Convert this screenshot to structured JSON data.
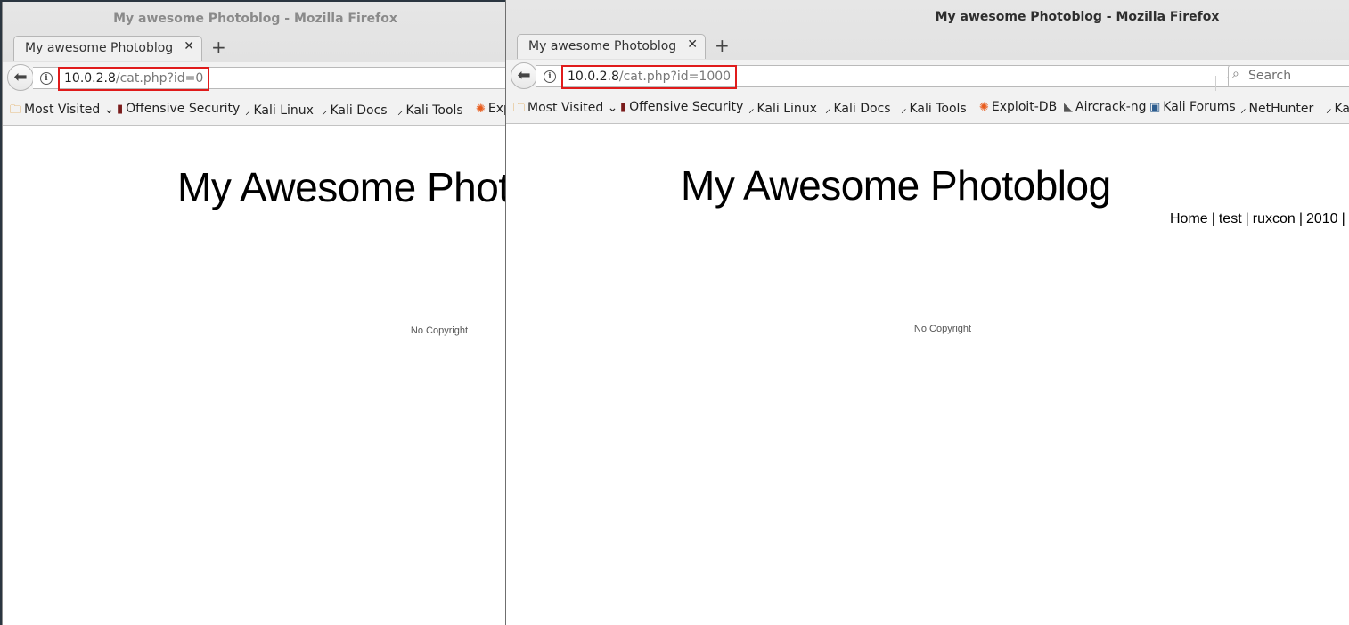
{
  "left_window": {
    "title": "My awesome Photoblog - Mozilla Firefox",
    "tab_title": "My awesome Photoblog",
    "url_host": "10.0.2.8",
    "url_path": "/cat.php?id=0",
    "bookmarks": [
      "Most Visited",
      "Offensive Security",
      "Kali Linux",
      "Kali Docs",
      "Kali Tools",
      "Exploit-DB"
    ],
    "site_title": "My Awesome Photoblog",
    "footer": "No Copyright"
  },
  "right_window": {
    "title": "My awesome Photoblog - Mozilla Firefox",
    "tab_title": "My awesome Photoblog",
    "url_host": "10.0.2.8",
    "url_path": "/cat.php?id=1000",
    "search_placeholder": "Search",
    "bookmarks": [
      "Most Visited",
      "Offensive Security",
      "Kali Linux",
      "Kali Docs",
      "Kali Tools",
      "Exploit-DB",
      "Aircrack-ng",
      "Kali Forums",
      "NetHunter",
      "Kali Training"
    ],
    "site_title": "My Awesome Photoblog",
    "nav": [
      "Home",
      "test",
      "ruxcon",
      "2010"
    ],
    "footer": "No Copyright"
  },
  "colors": {
    "highlight_border": "#e01b1b",
    "desktop": "#2b3640"
  }
}
